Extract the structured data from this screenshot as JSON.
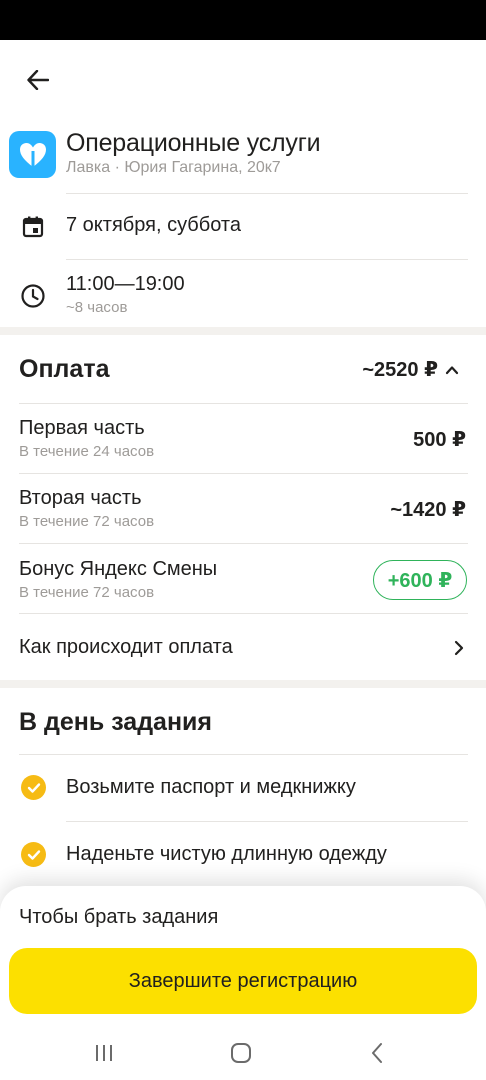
{
  "service": {
    "title": "Операционные услуги",
    "subtitle": "Лавка · Юрия Гагарина, 20к7",
    "logo_color": "#29b3ff"
  },
  "schedule": {
    "date": "7 октября, суббота",
    "time": "11:00—19:00",
    "duration": "~8 часов"
  },
  "payment": {
    "title": "Оплата",
    "total": "~2520 ₽",
    "lines": [
      {
        "title": "Первая часть",
        "sub": "В течение 24 часов",
        "value": "500 ₽"
      },
      {
        "title": "Вторая часть",
        "sub": "В течение 72 часов",
        "value": "~1420 ₽"
      },
      {
        "title": "Бонус Яндекс Смены",
        "sub": "В течение 72 часов",
        "value": "+600 ₽"
      }
    ],
    "how_link": "Как происходит оплата",
    "bonus_color": "#2fb35a"
  },
  "task_day": {
    "title": "В день задания",
    "items": [
      "Возьмите паспорт и медкнижку",
      "Наденьте чистую длинную одежду"
    ],
    "check_color": "#f6bb14"
  },
  "bottom_sheet": {
    "text": "Чтобы брать задания",
    "cta_label": "Завершите регистрацию",
    "cta_color": "#fce000"
  },
  "icons": {
    "back": "arrow-left-icon",
    "calendar": "calendar-icon",
    "clock": "clock-icon",
    "chevron_up": "chevron-up-icon",
    "chevron_right": "chevron-right-icon",
    "check": "check-icon",
    "nav_recents": "recents-icon",
    "nav_home": "home-icon",
    "nav_back": "nav-back-icon"
  }
}
